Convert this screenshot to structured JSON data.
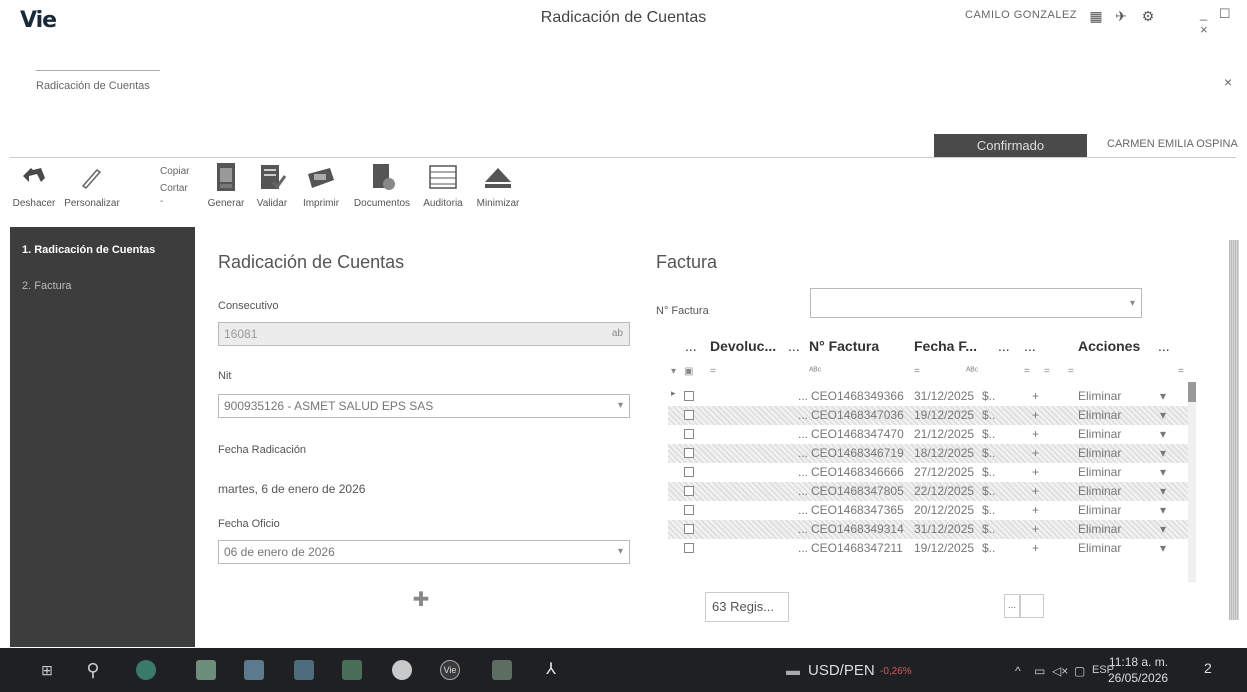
{
  "window": {
    "logo": "Vie",
    "title": "Radicación de Cuentas",
    "user": "CAMILO GONZALEZ",
    "controls": "_ ☐ ×"
  },
  "breadcrumb": "Radicación de Cuentas",
  "status": {
    "badge": "Confirmado",
    "assignee": "CARMEN EMILIA OSPINA"
  },
  "ribbon": {
    "undo": "Deshacer",
    "customize": "Personalizar",
    "copy": "Copiar",
    "cut": "Cortar",
    "generate": "Generar",
    "validate": "Validar",
    "print": "Imprimir",
    "documents": "Documentos",
    "audit": "Auditoria",
    "minimize": "Minimizar"
  },
  "nav": {
    "items": [
      {
        "label": "1. Radicación de Cuentas"
      },
      {
        "label": "2. Factura"
      }
    ]
  },
  "form": {
    "title": "Radicación de Cuentas",
    "consecutivo_label": "Consecutivo",
    "consecutivo_value": "16081",
    "nit_label": "Nit",
    "nit_value": "900935126 - ASMET SALUD EPS SAS",
    "fecha_radicacion_label": "Fecha Radicación",
    "fecha_radicacion_value": "martes, 6 de enero de 2026",
    "fecha_oficio_label": "Fecha Oficio",
    "fecha_oficio_value": "06 de enero de 2026"
  },
  "invoice": {
    "title": "Factura",
    "number_label": "N° Factura",
    "number_value": "",
    "columns": {
      "dots1": "...",
      "devolucion": "Devoluc...",
      "dots2": "...",
      "nfactura": "N° Factura",
      "fecha": "Fecha F...",
      "dots3": "...",
      "dots4": "...",
      "acciones": "Acciones",
      "dots5": "..."
    },
    "rows": [
      {
        "nfactura": "CEO1468349366",
        "fecha": "31/12/2025",
        "valor": "$..",
        "action": "Eliminar"
      },
      {
        "nfactura": "CEO1468347036",
        "fecha": "19/12/2025",
        "valor": "$..",
        "action": "Eliminar"
      },
      {
        "nfactura": "CEO1468347470",
        "fecha": "21/12/2025",
        "valor": "$..",
        "action": "Eliminar"
      },
      {
        "nfactura": "CEO1468346719",
        "fecha": "18/12/2025",
        "valor": "$..",
        "action": "Eliminar"
      },
      {
        "nfactura": "CEO1468346666",
        "fecha": "27/12/2025",
        "valor": "$..",
        "action": "Eliminar"
      },
      {
        "nfactura": "CEO1468347805",
        "fecha": "22/12/2025",
        "valor": "$..",
        "action": "Eliminar"
      },
      {
        "nfactura": "CEO1468347365",
        "fecha": "20/12/2025",
        "valor": "$..",
        "action": "Eliminar"
      },
      {
        "nfactura": "CEO1468349314",
        "fecha": "31/12/2025",
        "valor": "$..",
        "action": "Eliminar"
      },
      {
        "nfactura": "CEO1468347211",
        "fecha": "19/12/2025",
        "valor": "$..",
        "action": "Eliminar"
      }
    ],
    "footer_count": "63 Regis...",
    "footer_more": "..."
  },
  "taskbar": {
    "currency": "USD/PEN",
    "currency_change": "-0,26%",
    "lang": "ESP",
    "time": "11:18 a. m.",
    "date": "26/05/2026",
    "notifications": "2"
  },
  "colors": {
    "nav_bg": "#3d3d3d",
    "badge_bg": "#4a4a4a",
    "taskbar_bg": "#1f2024"
  }
}
